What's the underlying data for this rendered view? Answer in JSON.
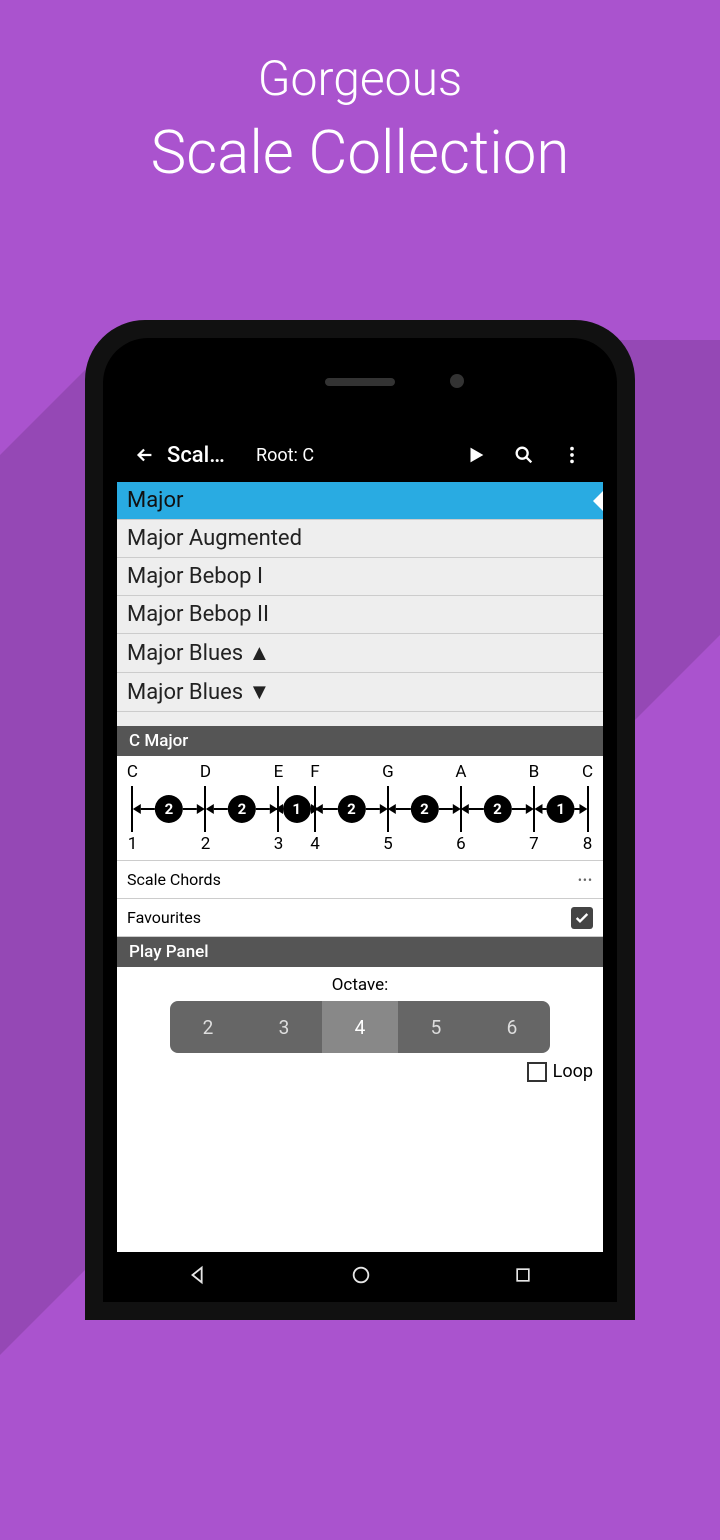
{
  "promo": {
    "line1": "Gorgeous",
    "line2": "Scale Collection"
  },
  "actionbar": {
    "title": "Scal…",
    "root": "Root: C"
  },
  "scales": {
    "items": [
      "Major",
      "Major Augmented",
      "Major Bebop I",
      "Major Bebop II",
      "Major Blues ▲",
      "Major Blues ▼"
    ],
    "selected_index": 0
  },
  "diagram": {
    "title": "C Major",
    "notes": [
      "C",
      "D",
      "E",
      "F",
      "G",
      "A",
      "B",
      "C"
    ],
    "degrees": [
      "1",
      "2",
      "3",
      "4",
      "5",
      "6",
      "7",
      "8"
    ],
    "intervals": [
      "2",
      "2",
      "1",
      "2",
      "2",
      "2",
      "1"
    ],
    "positions_pct": [
      2,
      17.4,
      32.8,
      40.5,
      55.9,
      71.3,
      86.7,
      98
    ]
  },
  "rows": {
    "scale_chords": "Scale Chords",
    "favourites": "Favourites"
  },
  "play": {
    "title": "Play Panel",
    "octave_label": "Octave:",
    "octaves": [
      "2",
      "3",
      "4",
      "5",
      "6"
    ],
    "selected_octave": "4",
    "loop": "Loop"
  }
}
